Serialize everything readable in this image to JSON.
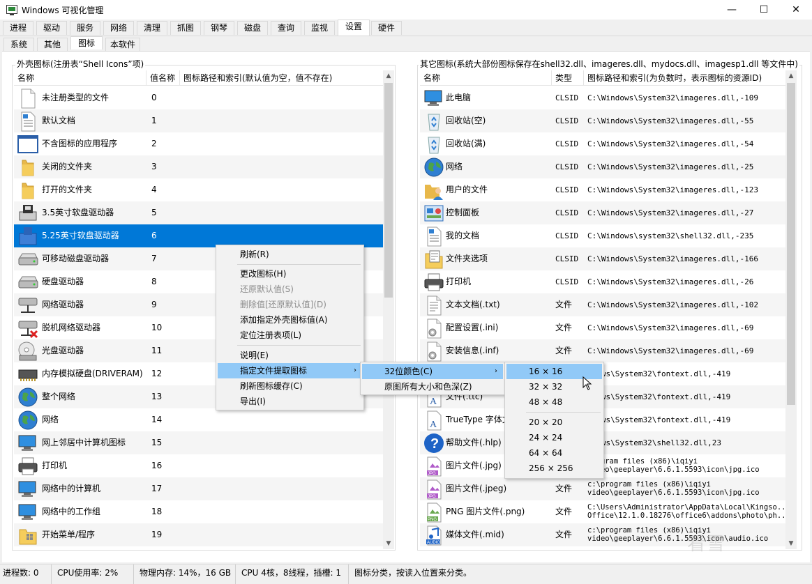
{
  "window": {
    "title": "Windows 可视化管理",
    "min": "—",
    "max": "☐",
    "close": "✕"
  },
  "main_tabs": [
    "进程",
    "驱动",
    "服务",
    "网络",
    "清理",
    "抓图",
    "钢琴",
    "磁盘",
    "查询",
    "监视",
    "设置",
    "硬件"
  ],
  "active_main_tab": "设置",
  "sub_tabs": [
    "系统",
    "其他",
    "图标",
    "本软件"
  ],
  "active_sub_tab": "图标",
  "left_group": {
    "label": "外壳图标(注册表“Shell Icons”项)",
    "headers": [
      "名称",
      "值名称",
      "图标路径和索引(默认值为空，值不存在)"
    ],
    "rows": [
      {
        "name": "未注册类型的文件",
        "value": "0",
        "icon": "blank-file-icon"
      },
      {
        "name": "默认文档",
        "value": "1",
        "icon": "document-icon"
      },
      {
        "name": "不含图标的应用程序",
        "value": "2",
        "icon": "application-window-icon"
      },
      {
        "name": "关闭的文件夹",
        "value": "3",
        "icon": "closed-folder-icon"
      },
      {
        "name": "打开的文件夹",
        "value": "4",
        "icon": "open-folder-icon"
      },
      {
        "name": "3.5英寸软盘驱动器",
        "value": "5",
        "icon": "floppy-35-icon"
      },
      {
        "name": "5.25英寸软盘驱动器",
        "value": "6",
        "icon": "floppy-525-icon"
      },
      {
        "name": "可移动磁盘驱动器",
        "value": "7",
        "icon": "removable-drive-icon"
      },
      {
        "name": "硬盘驱动器",
        "value": "8",
        "icon": "hard-drive-icon"
      },
      {
        "name": "网络驱动器",
        "value": "9",
        "icon": "network-drive-icon"
      },
      {
        "name": "脱机网络驱动器",
        "value": "10",
        "icon": "offline-network-drive-icon"
      },
      {
        "name": "光盘驱动器",
        "value": "11",
        "icon": "cd-drive-icon"
      },
      {
        "name": "内存模拟硬盘(DRIVERAM)",
        "value": "12",
        "icon": "ram-disk-icon"
      },
      {
        "name": "整个网络",
        "value": "13",
        "icon": "globe-icon"
      },
      {
        "name": "网络",
        "value": "14",
        "icon": "network-globe-icon"
      },
      {
        "name": "网上邻居中计算机图标",
        "value": "15",
        "icon": "computer-icon"
      },
      {
        "name": "打印机",
        "value": "16",
        "icon": "printer-icon"
      },
      {
        "name": "网络中的计算机",
        "value": "17",
        "icon": "network-computer-icon"
      },
      {
        "name": "网络中的工作组",
        "value": "18",
        "icon": "workgroup-icon"
      },
      {
        "name": "开始菜单/程序",
        "value": "19",
        "icon": "start-menu-programs-icon"
      }
    ],
    "selected_index": 6
  },
  "right_group": {
    "label": "其它图标(系统大部份图标保存在shell32.dll、imageres.dll、mydocs.dll、imagesp1.dll 等文件中)",
    "headers": [
      "名称",
      "类型",
      "图标路径和索引(为负数时，表示图标的资源ID)"
    ],
    "rows": [
      {
        "name": "此电脑",
        "type": "CLSID",
        "path": "C:\\Windows\\System32\\imageres.dll,-109",
        "icon": "this-pc-icon"
      },
      {
        "name": "回收站(空)",
        "type": "CLSID",
        "path": "C:\\Windows\\System32\\imageres.dll,-55",
        "icon": "recycle-bin-empty-icon"
      },
      {
        "name": "回收站(满)",
        "type": "CLSID",
        "path": "C:\\Windows\\System32\\imageres.dll,-54",
        "icon": "recycle-bin-full-icon"
      },
      {
        "name": "网络",
        "type": "CLSID",
        "path": "C:\\Windows\\System32\\imageres.dll,-25",
        "icon": "network-icon"
      },
      {
        "name": "用户的文件",
        "type": "CLSID",
        "path": "C:\\Windows\\System32\\imageres.dll,-123",
        "icon": "user-files-icon"
      },
      {
        "name": "控制面板",
        "type": "CLSID",
        "path": "C:\\Windows\\System32\\imageres.dll,-27",
        "icon": "control-panel-icon"
      },
      {
        "name": "我的文档",
        "type": "CLSID",
        "path": "C:\\Windows\\system32\\shell32.dll,-235",
        "icon": "my-documents-icon"
      },
      {
        "name": "文件夹选项",
        "type": "CLSID",
        "path": "C:\\Windows\\System32\\imageres.dll,-166",
        "icon": "folder-options-icon"
      },
      {
        "name": "打印机",
        "type": "CLSID",
        "path": "C:\\Windows\\System32\\imageres.dll,-26",
        "icon": "printer-icon"
      },
      {
        "name": "文本文档(.txt)",
        "type": "文件",
        "path": "C:\\Windows\\System32\\imageres.dll,-102",
        "icon": "text-document-icon"
      },
      {
        "name": "配置设置(.ini)",
        "type": "文件",
        "path": "C:\\Windows\\System32\\imageres.dll,-69",
        "icon": "ini-settings-icon"
      },
      {
        "name": "安装信息(.inf)",
        "type": "文件",
        "path": "C:\\Windows\\System32\\imageres.dll,-69",
        "icon": "inf-settings-icon"
      },
      {
        "name": "",
        "type": "",
        "path": "ndows\\System32\\fontext.dll,-419",
        "icon": "font-icon"
      },
      {
        "name": "文件(.ttc)",
        "type": "",
        "path": "ndows\\System32\\fontext.dll,-419",
        "icon": "font-collection-icon"
      },
      {
        "name": "TrueType 字体文",
        "type": "",
        "path": "ndows\\System32\\fontext.dll,-419",
        "icon": "truetype-font-icon"
      },
      {
        "name": "帮助文件(.hlp)",
        "type": "",
        "path": "ndows\\System32\\shell32.dll,23",
        "icon": "help-icon"
      },
      {
        "name": "图片文件(.jpg)",
        "type": "",
        "path": "program files (x86)\\iqiyi",
        "path2": "video\\geeplayer\\6.6.1.5593\\icon\\jpg.ico",
        "icon": "jpg-file-icon"
      },
      {
        "name": "图片文件(.jpeg)",
        "type": "文件",
        "path": "c:\\program files (x86)\\iqiyi",
        "path2": "video\\geeplayer\\6.6.1.5593\\icon\\jpg.ico",
        "icon": "jpeg-file-icon"
      },
      {
        "name": "PNG 图片文件(.png)",
        "type": "文件",
        "path": "C:\\Users\\Administrator\\AppData\\Local\\Kingso...",
        "path2": "Office\\12.1.0.18276\\office6\\addons\\photo\\ph...",
        "icon": "png-file-icon"
      },
      {
        "name": "媒体文件(.mid)",
        "type": "文件",
        "path": "c:\\program files (x86)\\iqiyi",
        "path2": "video\\geeplayer\\6.6.1.5593\\icon\\audio.ico",
        "icon": "audio-file-icon"
      }
    ]
  },
  "context_menu": {
    "items": [
      {
        "label": "刷新(R)",
        "disabled": false
      },
      {
        "sep": true
      },
      {
        "label": "更改图标(H)",
        "disabled": false
      },
      {
        "label": "还原默认值(S)",
        "disabled": true
      },
      {
        "label": "删除值[还原默认值](D)",
        "disabled": true
      },
      {
        "label": "添加指定外壳图标值(A)",
        "disabled": false
      },
      {
        "label": "定位注册表项(L)",
        "disabled": false
      },
      {
        "sep": true
      },
      {
        "label": "说明(E)",
        "disabled": false
      },
      {
        "label": "指定文件提取图标",
        "disabled": false,
        "submenu": true,
        "highlighted": true
      },
      {
        "label": "刷新图标缓存(C)",
        "disabled": false
      },
      {
        "label": "导出(I)",
        "disabled": false
      }
    ]
  },
  "submenu1": {
    "items": [
      {
        "label": "32位颜色(C)",
        "submenu": true,
        "highlighted": true
      },
      {
        "label": "原图所有大小和色深(Z)"
      }
    ]
  },
  "submenu2": {
    "items": [
      {
        "label": "16 × 16",
        "highlighted": true
      },
      {
        "label": "32 × 32"
      },
      {
        "label": "48 × 48"
      },
      {
        "sep": true
      },
      {
        "label": "20 × 20"
      },
      {
        "label": "24 × 24"
      },
      {
        "label": "64 × 64"
      },
      {
        "label": "256 × 256"
      }
    ]
  },
  "status": {
    "process_count": "进程数: 0",
    "cpu_usage": "CPU使用率: 2%",
    "memory": "物理内存: 14%，16 GB",
    "cpu_info": "CPU 4核，8线程，插槽: 1",
    "hint": "图标分类，按读入位置来分类。"
  },
  "watermark": "看雪",
  "colors": {
    "selection": "#0078d7",
    "menu_highlight": "#91c9f7",
    "window_bg": "#f0f0f0"
  }
}
